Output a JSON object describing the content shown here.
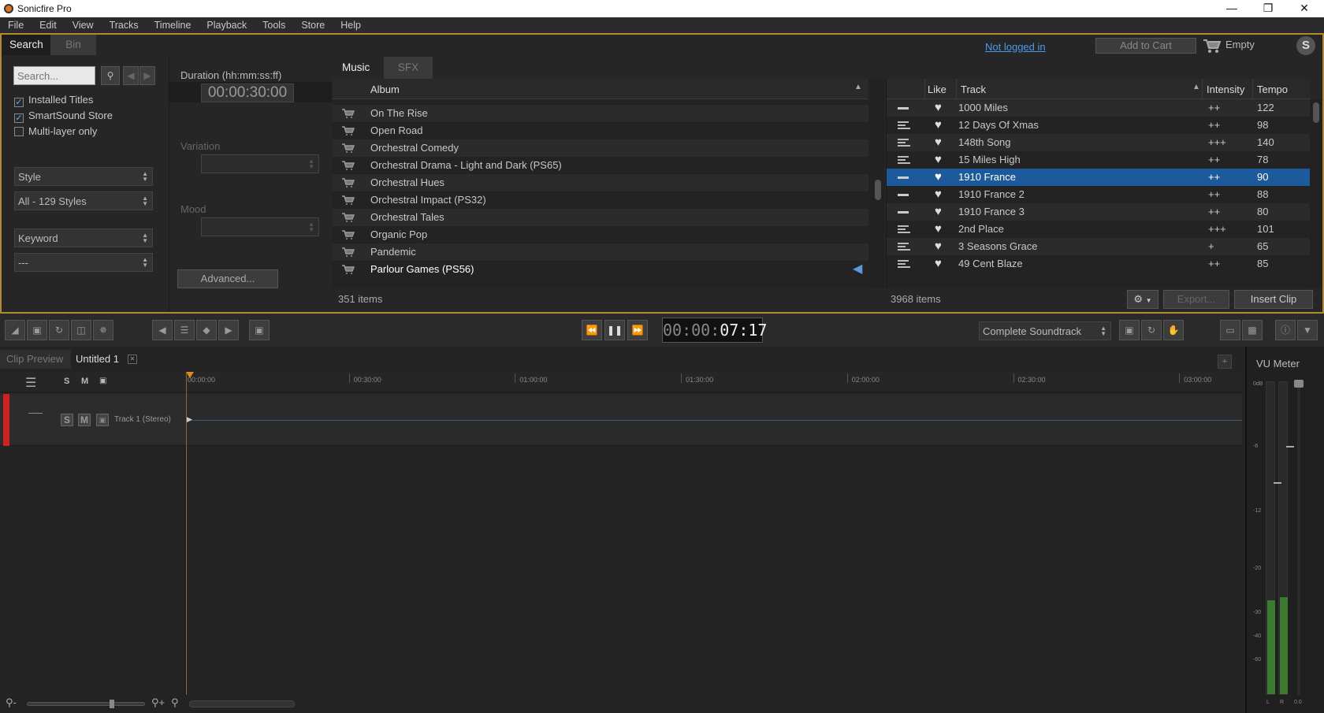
{
  "window": {
    "title": "Sonicfire Pro"
  },
  "menu": [
    "File",
    "Edit",
    "View",
    "Tracks",
    "Timeline",
    "Playback",
    "Tools",
    "Store",
    "Help"
  ],
  "top_tabs": {
    "search": "Search",
    "bin": "Bin"
  },
  "account": {
    "login_link": "Not logged in",
    "add_to_cart": "Add to Cart",
    "cart_status": "Empty"
  },
  "filters": {
    "search_placeholder": "Search...",
    "installed_titles": "Installed Titles",
    "smartsound_store": "SmartSound Store",
    "multi_layer_only": "Multi-layer only",
    "style": "Style",
    "style_value": "All - 129 Styles",
    "keyword": "Keyword",
    "keyword_value": "---"
  },
  "duration": {
    "label": "Duration (hh:mm:ss:ff)",
    "value": "00:00:30:00",
    "variation": "Variation",
    "mood": "Mood",
    "advanced": "Advanced..."
  },
  "library_tabs": {
    "music": "Music",
    "sfx": "SFX"
  },
  "albums": {
    "header": "Album",
    "count": "351 items",
    "items": [
      "On The Rise",
      "Open Road",
      "Orchestral Comedy",
      "Orchestral Drama - Light and Dark (PS65)",
      "Orchestral Hues",
      "Orchestral Impact (PS32)",
      "Orchestral Tales",
      "Organic Pop",
      "Pandemic",
      "Parlour Games (PS56)"
    ]
  },
  "tracks": {
    "headers": {
      "like": "Like",
      "track": "Track",
      "intensity": "Intensity",
      "tempo": "Tempo"
    },
    "count": "3968 items",
    "rows": [
      {
        "name": "1000 Miles",
        "intensity": "++",
        "tempo": "122"
      },
      {
        "name": "12 Days Of Xmas",
        "intensity": "++",
        "tempo": "98"
      },
      {
        "name": "148th Song",
        "intensity": "+++",
        "tempo": "140"
      },
      {
        "name": "15 Miles High",
        "intensity": "++",
        "tempo": "78"
      },
      {
        "name": "1910 France",
        "intensity": "++",
        "tempo": "90"
      },
      {
        "name": "1910 France 2",
        "intensity": "++",
        "tempo": "88"
      },
      {
        "name": "1910 France 3",
        "intensity": "++",
        "tempo": "80"
      },
      {
        "name": "2nd Place",
        "intensity": "+++",
        "tempo": "101"
      },
      {
        "name": "3 Seasons Grace",
        "intensity": "+",
        "tempo": "65"
      },
      {
        "name": "49 Cent Blaze",
        "intensity": "++",
        "tempo": "85"
      }
    ],
    "export": "Export...",
    "insert_clip": "Insert Clip"
  },
  "transport": {
    "time_dim": "00:00:",
    "time_bright": "07:17",
    "mode": "Complete Soundtrack"
  },
  "timeline": {
    "tabs": {
      "clip_preview": "Clip Preview",
      "untitled": "Untitled 1"
    },
    "header_s": "S",
    "header_m": "M",
    "ruler": [
      "00:00:00",
      "00:30:00",
      "01:00:00",
      "01:30:00",
      "02:00:00",
      "02:30:00",
      "03:00:00"
    ],
    "track_name": "Track 1 (Stereo)",
    "track_s": "S",
    "track_m": "M"
  },
  "vu": {
    "title": "VU Meter",
    "scale": [
      "0dB",
      "-6",
      "-12",
      "-20",
      "-30",
      "-40",
      "-60"
    ],
    "left": "L",
    "right": "R",
    "readout": "0.0",
    "levels": {
      "left": 0.3,
      "right": 0.31
    }
  },
  "colors": {
    "accent_border": "#b08a2e",
    "selection": "#1d5a9c",
    "track_color": "#d02020"
  }
}
